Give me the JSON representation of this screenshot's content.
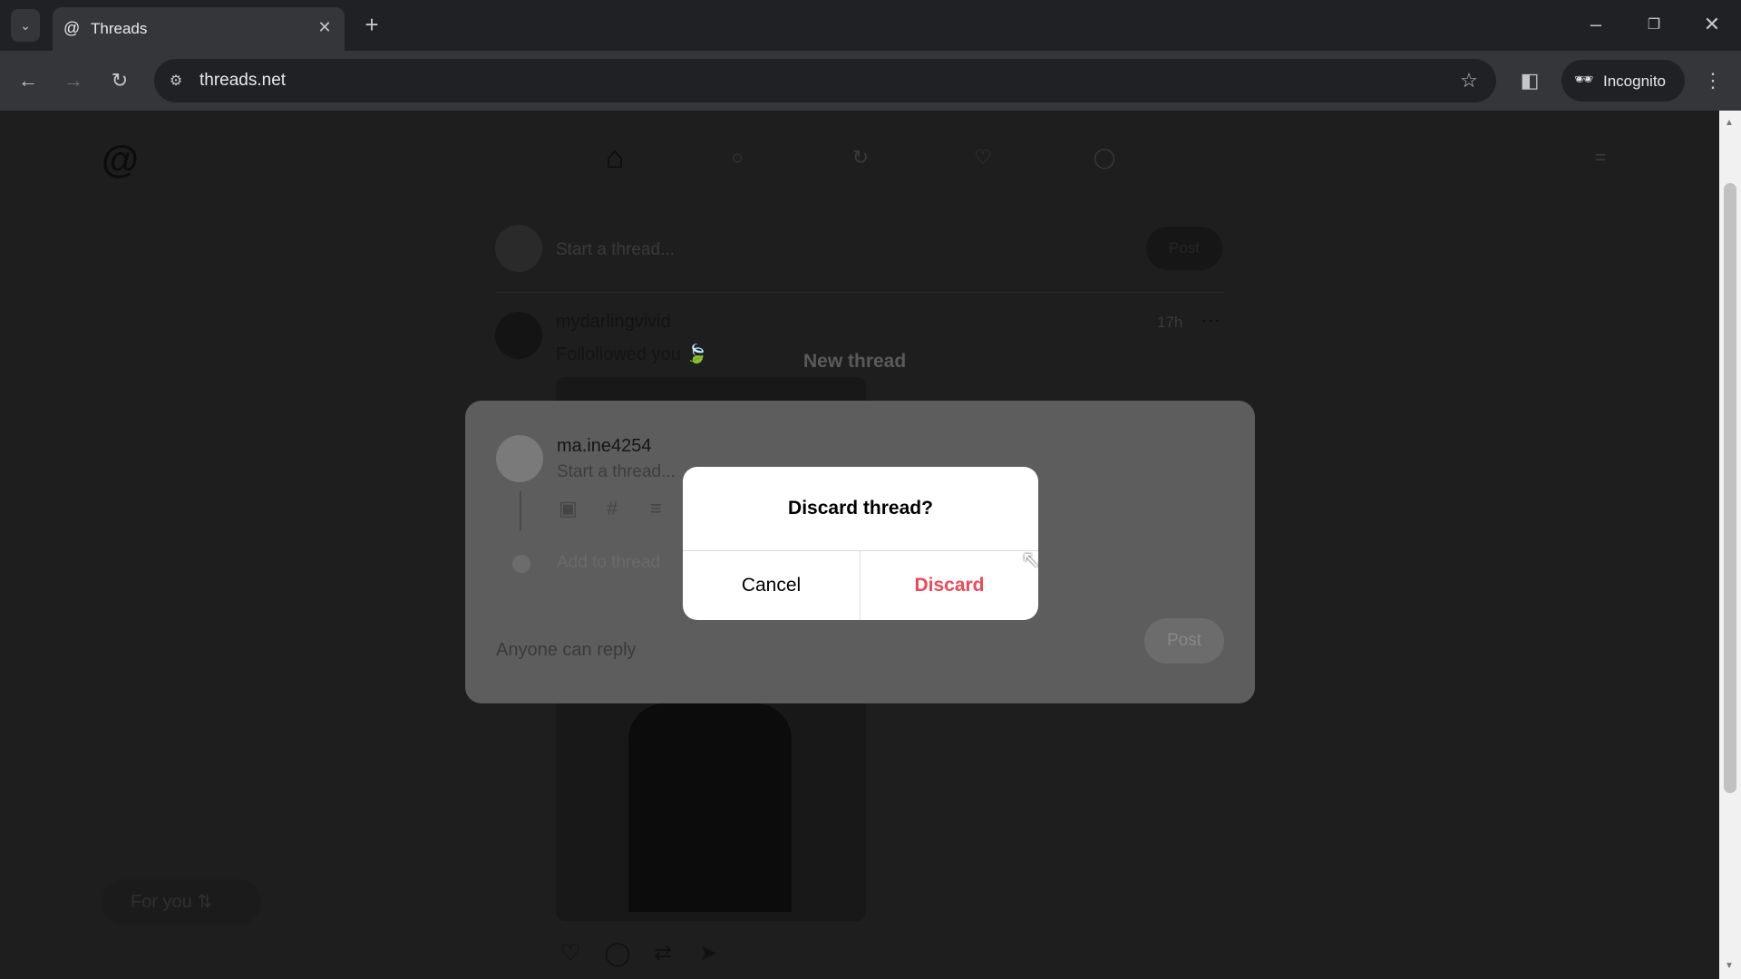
{
  "browser": {
    "tab_title": "Threads",
    "url": "threads.net",
    "profile_label": "Incognito"
  },
  "nav": {
    "icons": [
      "home-icon",
      "search-icon",
      "compose-icon",
      "heart-icon",
      "profile-icon"
    ]
  },
  "feed": {
    "start_placeholder": "Start a thread...",
    "post_button": "Post",
    "post": {
      "username": "mydarlingvivid",
      "text": "Follollowed you 🍃",
      "time": "17h"
    },
    "for_you": "For you"
  },
  "composer": {
    "title": "New thread",
    "username": "ma.ine4254",
    "placeholder": "Start a thread...",
    "add_to_thread": "Add to thread",
    "reply_setting": "Anyone can reply",
    "post_button": "Post"
  },
  "dialog": {
    "title": "Discard thread?",
    "cancel": "Cancel",
    "discard": "Discard",
    "discard_color": "#ed4956"
  }
}
